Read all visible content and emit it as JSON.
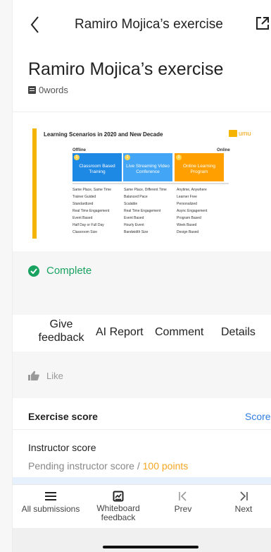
{
  "header": {
    "title": "Ramiro Mojica’s exercise"
  },
  "doc": {
    "title": "Ramiro Mojica’s exercise",
    "word_count": "0words"
  },
  "slide": {
    "title": "Learning Scenarios in 2020 and New Decade",
    "logo": "umu",
    "offline": "Offline",
    "online": "Online",
    "columns": [
      {
        "num": "1",
        "label": "Classroom Based Training"
      },
      {
        "num": "2",
        "label": "Live Streaming Video Conference"
      },
      {
        "num": "3",
        "label": "Online Learning Program"
      }
    ],
    "rows": [
      [
        "Same Place, Same Time",
        "Same Place, Different Time",
        "Anytime, Anywhere"
      ],
      [
        "Trainer Guided",
        "Balanced Pace",
        "Learner Free"
      ],
      [
        "Standardized",
        "Scalable",
        "Personalized"
      ],
      [
        "Real Time Engagement",
        "Real Time Engagement",
        "Async Engagement"
      ],
      [
        "Event Based",
        "Event Based",
        "Program Based"
      ],
      [
        "Half Day or Full Day",
        "Hourly Event",
        "Week Based"
      ],
      [
        "Classroom Size",
        "Bandwidth Size",
        "Design Based"
      ]
    ]
  },
  "status": {
    "label": "Complete",
    "color": "#1aa260"
  },
  "tabs": {
    "give_feedback": "Give feedback",
    "ai_report": "AI Report",
    "comment": "Comment",
    "details": "Details"
  },
  "like": {
    "label": "Like"
  },
  "score": {
    "section_label": "Exercise score",
    "link_label": "Score",
    "instructor_label": "Instructor score",
    "pending_text": "Pending instructor score / ",
    "points": "100 points"
  },
  "bottom_nav": {
    "all_submissions": "All submissions",
    "whiteboard_feedback": "Whiteboard feedback",
    "prev": "Prev",
    "next": "Next"
  }
}
